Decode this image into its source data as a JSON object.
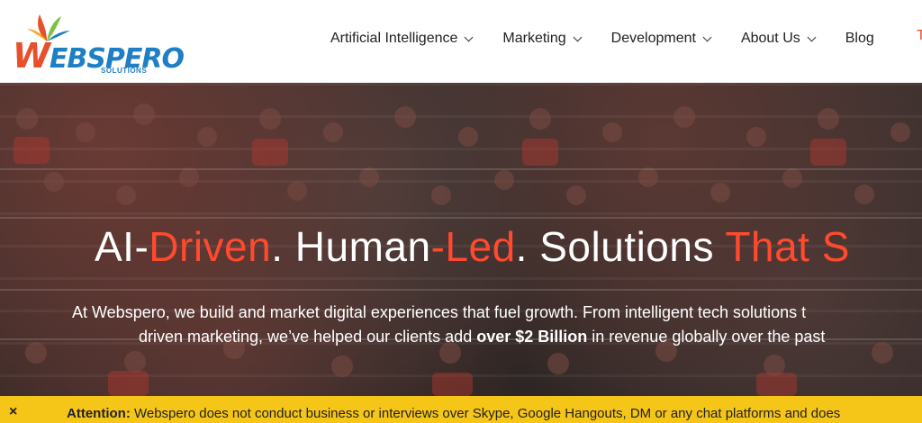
{
  "logo": {
    "initial": "W",
    "rest": "EBSPERO",
    "sub": "SOLUTIONS"
  },
  "nav": {
    "items": [
      {
        "label": "Artificial Intelligence",
        "dropdown": true
      },
      {
        "label": "Marketing",
        "dropdown": true
      },
      {
        "label": "Development",
        "dropdown": true
      },
      {
        "label": "About Us",
        "dropdown": true
      },
      {
        "label": "Blog",
        "dropdown": false
      }
    ],
    "clipped": "T"
  },
  "hero": {
    "title_parts": [
      "AI-",
      "Driven",
      ". Human",
      "-Led",
      ". Solutions ",
      "That S"
    ],
    "line1": "At Webspero, we build and market digital experiences that fuel growth. From intelligent tech solutions t",
    "line2_pre": "driven marketing, we’ve helped our clients add ",
    "line2_bold": "over $2 Billion",
    "line2_post": " in revenue globally over the past"
  },
  "attention": {
    "close_icon": "×",
    "label": "Attention:",
    "message": " Webspero does not conduct business or interviews over Skype, Google Hangouts, DM or any chat platforms and does"
  },
  "colors": {
    "accent": "#ff4a2e",
    "brand_blue": "#1f7fc4",
    "attention_bg": "#f5c518"
  }
}
